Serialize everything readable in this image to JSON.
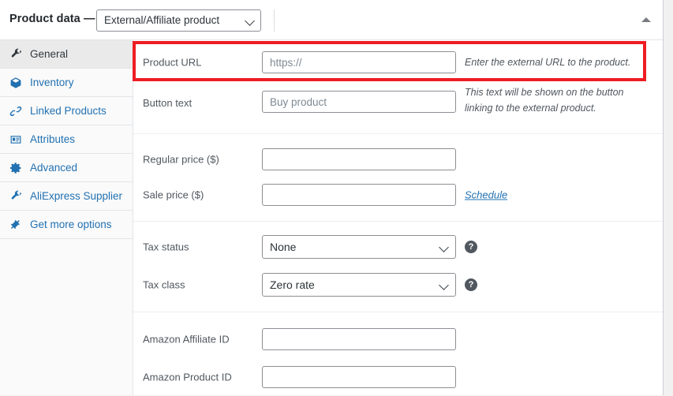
{
  "header": {
    "title": "Product data —",
    "product_type": "External/Affiliate product",
    "collapse_icon": "triangle-up-icon",
    "chevron_icon": "chevron-down-icon"
  },
  "sidebar": {
    "items": [
      {
        "label": "General",
        "icon": "wrench-icon",
        "active": true
      },
      {
        "label": "Inventory",
        "icon": "cube-icon",
        "active": false
      },
      {
        "label": "Linked Products",
        "icon": "link-icon",
        "active": false
      },
      {
        "label": "Attributes",
        "icon": "form-icon",
        "active": false
      },
      {
        "label": "Advanced",
        "icon": "gear-icon",
        "active": false
      },
      {
        "label": "AliExpress Supplier",
        "icon": "wrench-icon",
        "active": false
      },
      {
        "label": "Get more options",
        "icon": "plug-icon",
        "active": false
      }
    ]
  },
  "fields": {
    "product_url": {
      "label": "Product URL",
      "value": "",
      "placeholder": "https://",
      "description": "Enter the external URL to the product."
    },
    "button_text": {
      "label": "Button text",
      "value": "",
      "placeholder": "Buy product",
      "description": "This text will be shown on the button linking to the external product."
    },
    "regular_price": {
      "label": "Regular price ($)",
      "value": "",
      "placeholder": ""
    },
    "sale_price": {
      "label": "Sale price ($)",
      "value": "",
      "placeholder": "",
      "schedule_link": "Schedule"
    },
    "tax_status": {
      "label": "Tax status",
      "value": "None",
      "help": "?"
    },
    "tax_class": {
      "label": "Tax class",
      "value": "Zero rate",
      "help": "?"
    },
    "amazon_affiliate_id": {
      "label": "Amazon Affiliate ID",
      "value": "",
      "placeholder": ""
    },
    "amazon_product_id": {
      "label": "Amazon Product ID",
      "value": "",
      "placeholder": ""
    }
  },
  "annotation": {
    "highlight_color": "#ee1d23"
  }
}
